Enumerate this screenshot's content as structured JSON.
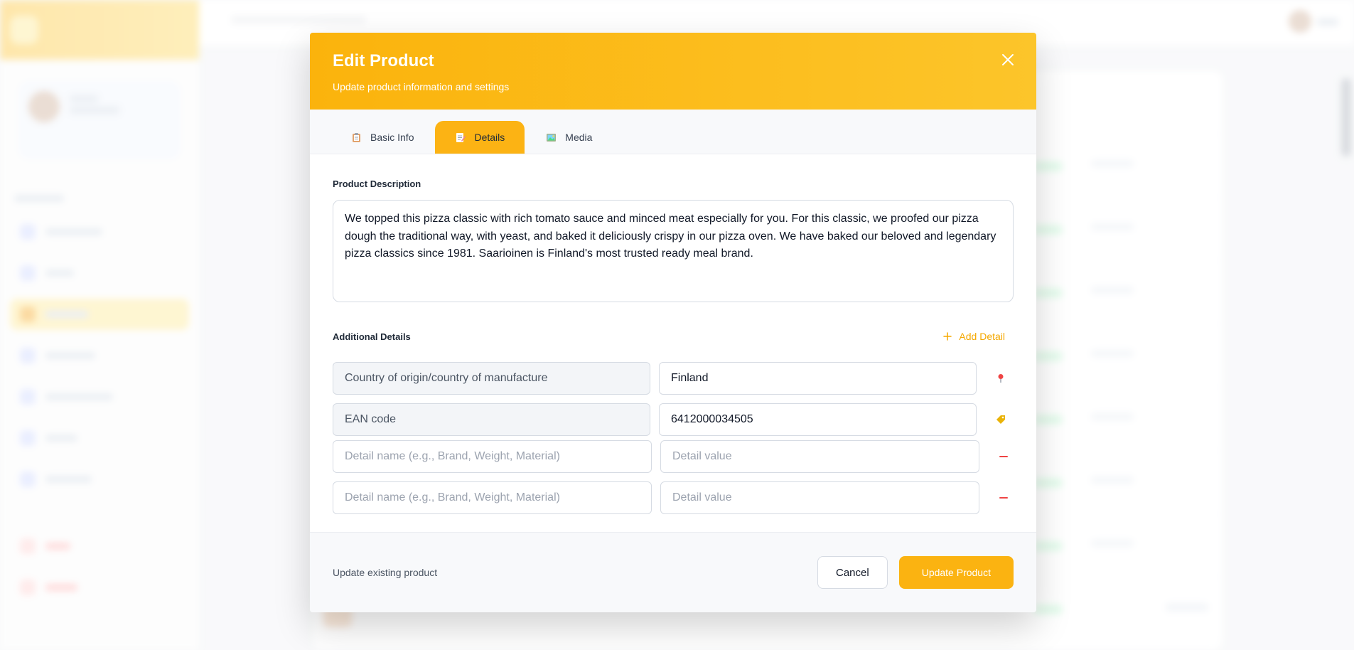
{
  "modal": {
    "title": "Edit Product",
    "subtitle": "Update product information and settings",
    "accent_color": "#fbb30c"
  },
  "tabs": [
    {
      "label": "Basic Info",
      "icon": "clipboard-icon",
      "active": false
    },
    {
      "label": "Details",
      "icon": "memo-icon",
      "active": true
    },
    {
      "label": "Media",
      "icon": "picture-icon",
      "active": false
    }
  ],
  "description": {
    "label": "Product Description",
    "value": "We topped this pizza classic with rich tomato sauce and minced meat especially for you. For this classic, we proofed our pizza dough the traditional way, with yeast, and baked it deliciously crispy in our pizza oven. We have baked our beloved and legendary pizza classics since 1981. Saarioinen is Finland's most trusted ready meal brand."
  },
  "additional_details": {
    "label": "Additional Details",
    "add_label": "Add Detail",
    "rows": [
      {
        "name": "Country of origin/country of manufacture",
        "value": "Finland",
        "action_icon": "pin-icon"
      },
      {
        "name": "EAN code",
        "value": "6412000034505",
        "action_icon": "tag-icon"
      }
    ],
    "empty_rows": [
      {
        "name_placeholder": "Detail name (e.g., Brand, Weight, Material)",
        "value_placeholder": "Detail value",
        "action_icon": "minus-icon"
      },
      {
        "name_placeholder": "Detail name (e.g., Brand, Weight, Material)",
        "value_placeholder": "Detail value",
        "action_icon": "minus-icon"
      }
    ]
  },
  "footer": {
    "note": "Update existing product",
    "cancel_label": "Cancel",
    "submit_label": "Update Product"
  }
}
